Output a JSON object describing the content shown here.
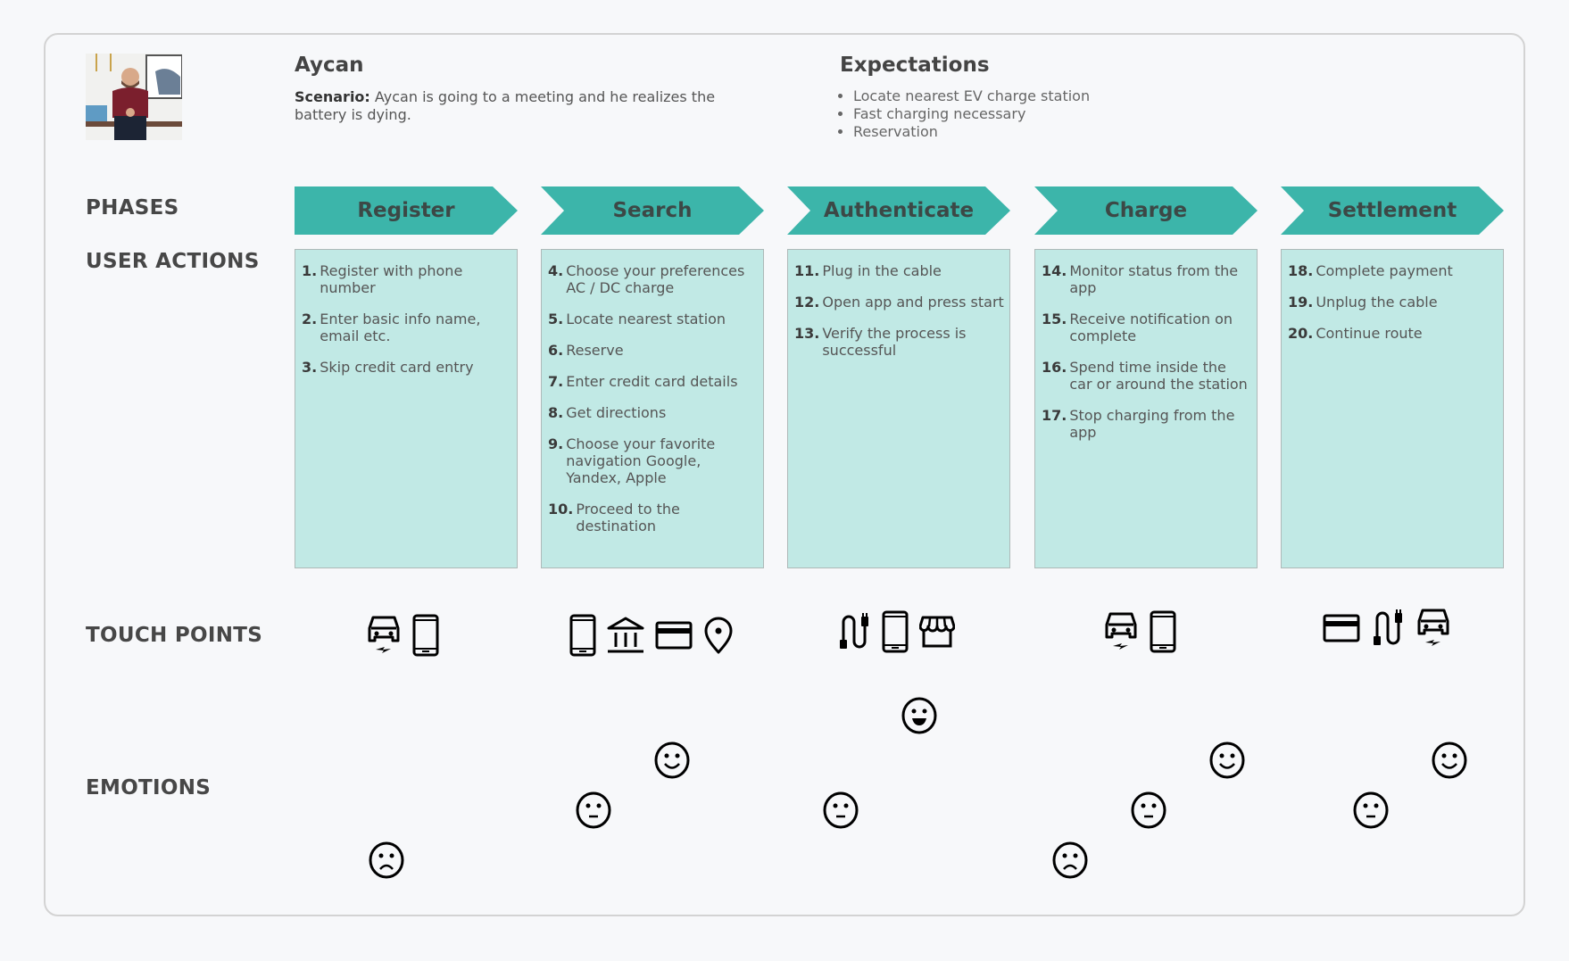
{
  "persona": {
    "name": "Aycan",
    "photo_icon": "persona-photo",
    "scenario_label": "Scenario:",
    "scenario_text": "Aycan is going to a meeting and he realizes the battery is dying."
  },
  "expectations": {
    "title": "Expectations",
    "items": [
      "Locate nearest EV charge station",
      "Fast charging necessary",
      "Reservation"
    ]
  },
  "row_labels": {
    "phases": "PHASES",
    "user_actions": "USER ACTIONS",
    "touch_points": "TOUCH POINTS",
    "emotions": "EMOTIONS"
  },
  "colors": {
    "phase_fill": "#3cb5aa",
    "card_fill": "#c1e9e5",
    "text": "#474747"
  },
  "phases": [
    {
      "label": "Register",
      "actions": [
        {
          "num": "1.",
          "text": "Register with phone number"
        },
        {
          "num": "2.",
          "text": "Enter basic info name, email etc."
        },
        {
          "num": "3.",
          "text": "Skip credit card entry"
        }
      ],
      "touch_points": [
        "ev-car-icon",
        "smartphone-icon"
      ],
      "emotions": [
        {
          "type": "sad",
          "level": 1
        }
      ]
    },
    {
      "label": "Search",
      "actions": [
        {
          "num": "4.",
          "text": "Choose your preferences AC / DC charge"
        },
        {
          "num": "5.",
          "text": "Locate nearest station"
        },
        {
          "num": "6.",
          "text": "Reserve"
        },
        {
          "num": "7.",
          "text": "Enter credit card details"
        },
        {
          "num": "8.",
          "text": "Get directions"
        },
        {
          "num": "9.",
          "text": "Choose your favorite navigation Google, Yandex, Apple"
        },
        {
          "num": "10.",
          "text": "Proceed to the destination"
        }
      ],
      "touch_points": [
        "smartphone-icon",
        "bank-icon",
        "credit-card-icon",
        "location-pin-icon"
      ],
      "emotions": [
        {
          "type": "neutral",
          "level": 2
        },
        {
          "type": "smile",
          "level": 3
        }
      ]
    },
    {
      "label": "Authenticate",
      "actions": [
        {
          "num": "11.",
          "text": "Plug in the cable"
        },
        {
          "num": "12.",
          "text": "Open app and press start"
        },
        {
          "num": "13.",
          "text": "Verify the process is successful"
        }
      ],
      "touch_points": [
        "charging-cable-icon",
        "smartphone-icon",
        "storefront-icon"
      ],
      "emotions": [
        {
          "type": "neutral",
          "level": 2
        },
        {
          "type": "grin",
          "level": 4
        }
      ]
    },
    {
      "label": "Charge",
      "actions": [
        {
          "num": "14.",
          "text": "Monitor status from the app"
        },
        {
          "num": "15.",
          "text": "Receive notification on complete"
        },
        {
          "num": "16.",
          "text": "Spend time inside the car or around the station"
        },
        {
          "num": "17.",
          "text": "Stop charging from the app"
        }
      ],
      "touch_points": [
        "ev-car-icon",
        "smartphone-icon"
      ],
      "emotions": [
        {
          "type": "sad",
          "level": 1
        },
        {
          "type": "neutral",
          "level": 2
        },
        {
          "type": "smile",
          "level": 3
        }
      ]
    },
    {
      "label": "Settlement",
      "actions": [
        {
          "num": "18.",
          "text": "Complete payment"
        },
        {
          "num": "19.",
          "text": "Unplug the cable"
        },
        {
          "num": "20.",
          "text": "Continue route"
        }
      ],
      "touch_points": [
        "credit-card-icon",
        "charging-cable-icon",
        "ev-car-icon"
      ],
      "emotions": [
        {
          "type": "neutral",
          "level": 2
        },
        {
          "type": "smile",
          "level": 3
        }
      ]
    }
  ]
}
